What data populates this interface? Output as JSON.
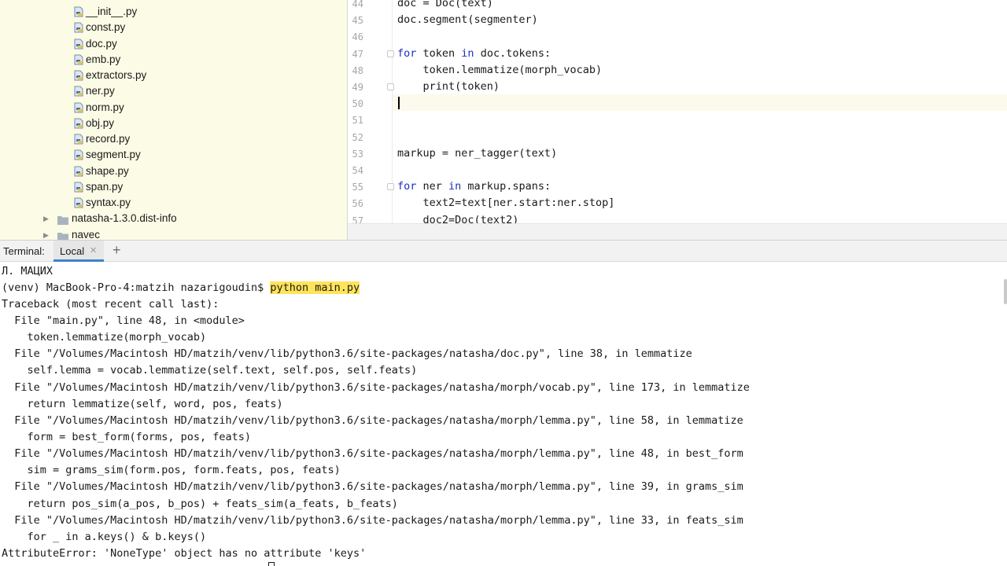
{
  "project_tree": {
    "files": [
      "__init__.py",
      "const.py",
      "doc.py",
      "emb.py",
      "extractors.py",
      "ner.py",
      "norm.py",
      "obj.py",
      "record.py",
      "segment.py",
      "shape.py",
      "span.py",
      "syntax.py"
    ],
    "folders": [
      "natasha-1.3.0.dist-info",
      "navec"
    ]
  },
  "editor": {
    "lines": [
      {
        "num": "44",
        "tokens": [
          {
            "t": "doc = Doc(text)",
            "k": false
          }
        ]
      },
      {
        "num": "45",
        "tokens": [
          {
            "t": "doc.segment(segmenter)",
            "k": false
          }
        ]
      },
      {
        "num": "46",
        "tokens": []
      },
      {
        "num": "47",
        "tokens": [
          {
            "t": "for",
            "k": true
          },
          {
            "t": " token ",
            "k": false
          },
          {
            "t": "in",
            "k": true
          },
          {
            "t": " doc.tokens:",
            "k": false
          }
        ]
      },
      {
        "num": "48",
        "tokens": [
          {
            "t": "    token.lemmatize(morph_vocab)",
            "k": false
          }
        ]
      },
      {
        "num": "49",
        "tokens": [
          {
            "t": "    print(token)",
            "k": false
          }
        ]
      },
      {
        "num": "50",
        "tokens": []
      },
      {
        "num": "51",
        "tokens": []
      },
      {
        "num": "52",
        "tokens": []
      },
      {
        "num": "53",
        "tokens": [
          {
            "t": "markup = ner_tagger(text)",
            "k": false
          }
        ]
      },
      {
        "num": "54",
        "tokens": []
      },
      {
        "num": "55",
        "tokens": [
          {
            "t": "for",
            "k": true
          },
          {
            "t": " ner ",
            "k": false
          },
          {
            "t": "in",
            "k": true
          },
          {
            "t": " markup.spans:",
            "k": false
          }
        ]
      },
      {
        "num": "56",
        "tokens": [
          {
            "t": "    text2=text[ner.start:ner.stop]",
            "k": false
          }
        ]
      },
      {
        "num": "57",
        "tokens": [
          {
            "t": "    doc2=Doc(text2)",
            "k": false
          }
        ]
      }
    ]
  },
  "terminal": {
    "panel_label": "Terminal:",
    "tab_label": "Local",
    "close_icon": "close-icon",
    "new_tab_icon": "plus-icon",
    "prompt": "(venv) MacBook-Pro-4:matzih nazarigoudin$ ",
    "command": "python main.py",
    "highlight_color": "#ffe35a",
    "output": [
      "Л. МАЦИХ",
      "__PROMPT__",
      "Traceback (most recent call last):",
      "  File \"main.py\", line 48, in <module>",
      "    token.lemmatize(morph_vocab)",
      "  File \"/Volumes/Macintosh HD/matzih/venv/lib/python3.6/site-packages/natasha/doc.py\", line 38, in lemmatize",
      "    self.lemma = vocab.lemmatize(self.text, self.pos, self.feats)",
      "  File \"/Volumes/Macintosh HD/matzih/venv/lib/python3.6/site-packages/natasha/morph/vocab.py\", line 173, in lemmatize",
      "    return lemmatize(self, word, pos, feats)",
      "  File \"/Volumes/Macintosh HD/matzih/venv/lib/python3.6/site-packages/natasha/morph/lemma.py\", line 58, in lemmatize",
      "    form = best_form(forms, pos, feats)",
      "  File \"/Volumes/Macintosh HD/matzih/venv/lib/python3.6/site-packages/natasha/morph/lemma.py\", line 48, in best_form",
      "    sim = grams_sim(form.pos, form.feats, pos, feats)",
      "  File \"/Volumes/Macintosh HD/matzih/venv/lib/python3.6/site-packages/natasha/morph/lemma.py\", line 39, in grams_sim",
      "    return pos_sim(a_pos, b_pos) + feats_sim(a_feats, b_feats)",
      "  File \"/Volumes/Macintosh HD/matzih/venv/lib/python3.6/site-packages/natasha/morph/lemma.py\", line 33, in feats_sim",
      "    for _ in a.keys() & b.keys()",
      "AttributeError: 'NoneType' object has no attribute 'keys'"
    ]
  },
  "colors": {
    "tree_background": "#fbfbe6",
    "keyword": "#1b2ec4",
    "tab_underline": "#4083c9"
  }
}
